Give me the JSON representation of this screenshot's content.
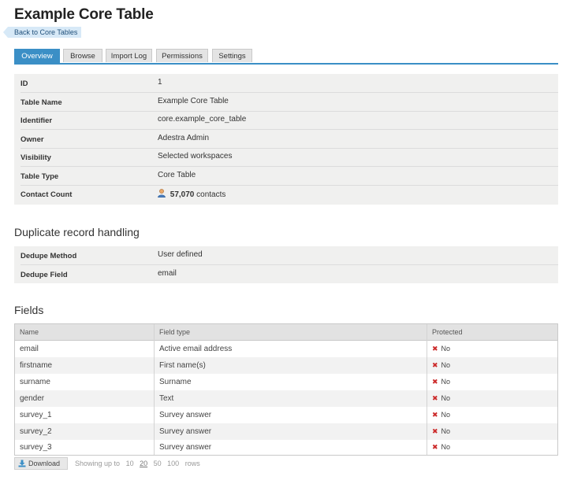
{
  "page": {
    "title": "Example Core Table",
    "back_label": "Back to Core Tables"
  },
  "tabs": [
    {
      "label": "Overview",
      "active": true
    },
    {
      "label": "Browse",
      "active": false
    },
    {
      "label": "Import Log",
      "active": false
    },
    {
      "label": "Permissions",
      "active": false
    },
    {
      "label": "Settings",
      "active": false
    }
  ],
  "overview": [
    {
      "key": "ID",
      "value": "1"
    },
    {
      "key": "Table Name",
      "value": "Example Core Table"
    },
    {
      "key": "Identifier",
      "value": "core.example_core_table"
    },
    {
      "key": "Owner",
      "value": "Adestra Admin"
    },
    {
      "key": "Visibility",
      "value": "Selected workspaces"
    },
    {
      "key": "Table Type",
      "value": "Core Table"
    },
    {
      "key": "Contact Count",
      "count": "57,070",
      "suffix": "contacts",
      "icon": "person-icon"
    }
  ],
  "dedupe": {
    "heading": "Duplicate record handling",
    "rows": [
      {
        "key": "Dedupe Method",
        "value": "User defined"
      },
      {
        "key": "Dedupe Field",
        "value": "email"
      }
    ]
  },
  "fields": {
    "heading": "Fields",
    "columns": [
      "Name",
      "Field type",
      "Protected"
    ],
    "rows": [
      {
        "name": "email",
        "type": "Active email address",
        "protected": "No"
      },
      {
        "name": "firstname",
        "type": "First name(s)",
        "protected": "No"
      },
      {
        "name": "surname",
        "type": "Surname",
        "protected": "No"
      },
      {
        "name": "gender",
        "type": "Text",
        "protected": "No"
      },
      {
        "name": "survey_1",
        "type": "Survey answer",
        "protected": "No"
      },
      {
        "name": "survey_2",
        "type": "Survey answer",
        "protected": "No"
      },
      {
        "name": "survey_3",
        "type": "Survey answer",
        "protected": "No"
      }
    ]
  },
  "footer": {
    "download_label": "Download",
    "showing_prefix": "Showing up to",
    "page_sizes": [
      "10",
      "20",
      "50",
      "100"
    ],
    "selected_size": "20",
    "suffix": "rows"
  },
  "colors": {
    "accent": "#3b8fc6",
    "no_mark": "#cc2a2a",
    "panel_bg": "#f0f0ef"
  }
}
